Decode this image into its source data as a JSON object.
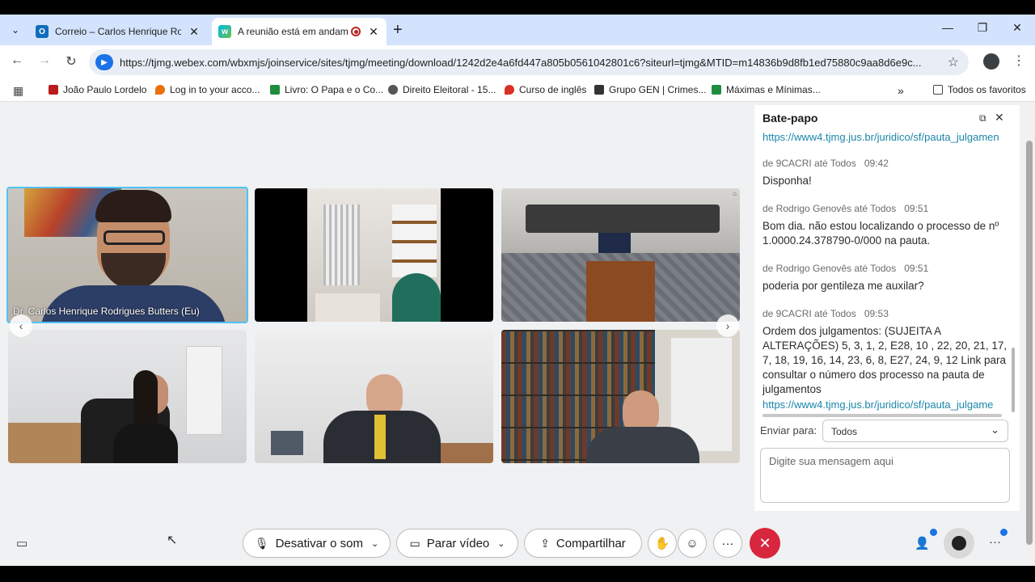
{
  "browser": {
    "tabs": [
      {
        "title": "Correio – Carlos Henrique Rodrigues Butters",
        "active": false
      },
      {
        "title": "A reunião está em andamento",
        "active": true
      }
    ],
    "url": "https://tjmg.webex.com/wbxmjs/joinservice/sites/tjmg/meeting/download/1242d2e4a6fd447a805b0561042801c6?siteurl=tjmg&MTID=m14836b9d8fb1ed75880c9aa8d6e9c...",
    "bookmarks": [
      "João Paulo Lordelo",
      "Log in to your acco...",
      "Livro: O Papa e o Co...",
      "Direito Eleitoral - 15...",
      "Curso de inglês",
      "Grupo GEN | Crimes...",
      "Máximas e Mínimas..."
    ],
    "all_bookmarks": "Todos os favoritos"
  },
  "meeting": {
    "self_name": "Dr. Carlos Henrique Rodrigues Butters (Eu)"
  },
  "chat": {
    "title": "Bate-papo",
    "top_link": "https://www4.tjmg.jus.br/juridico/sf/pauta_julgamen",
    "messages": [
      {
        "sender": "de 9CACRI até Todos",
        "time": "09:42",
        "text": "Disponha!"
      },
      {
        "sender": "de Rodrigo Genovês até Todos",
        "time": "09:51",
        "text": "Bom dia. não estou localizando o processo de nº 1.0000.24.378790-0/000 na pauta."
      },
      {
        "sender": "de Rodrigo Genovês até Todos",
        "time": "09:51",
        "text": "poderia por gentileza me auxilar?"
      },
      {
        "sender": "de 9CACRI até Todos",
        "time": "09:53",
        "text": "Ordem dos julgamentos: (SUJEITA A ALTERAÇÕES) 5, 3, 1, 2, E28, 10 , 22, 20, 21, 17, 7, 18, 19, 16, 14, 23, 6, 8, E27, 24, 9, 12 Link para consultar o número dos processo na pauta de julgamentos"
      }
    ],
    "bottom_link": "https://www4.tjmg.jus.br/juridico/sf/pauta_julgame",
    "send_to_label": "Enviar para:",
    "send_to_value": "Todos",
    "input_placeholder": "Digite sua mensagem aqui"
  },
  "controls": {
    "mute": "Desativar o som",
    "video": "Parar vídeo",
    "share": "Compartilhar"
  },
  "colors": {
    "accent": "#1a73e8",
    "leave": "#d7263d",
    "link": "#1b86a8"
  }
}
